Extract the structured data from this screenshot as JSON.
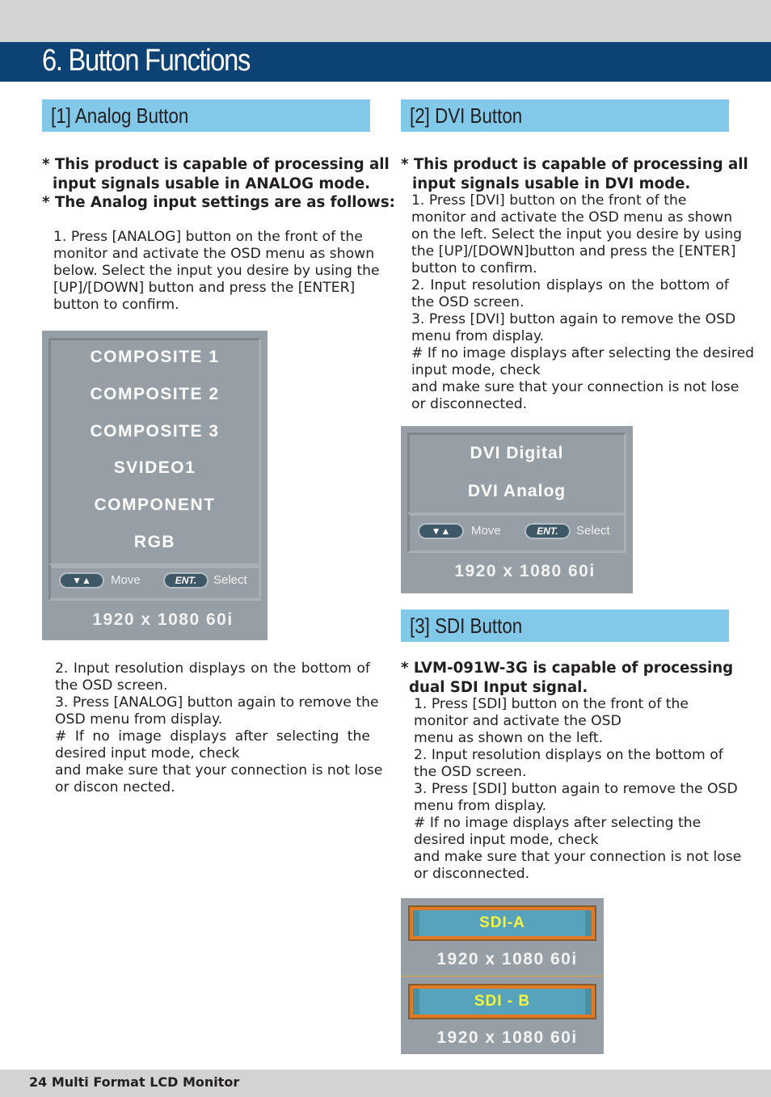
{
  "page": {
    "title": "6. Button Functions",
    "footer": "24 Multi Format LCD Monitor"
  },
  "analog": {
    "heading": "[1] Analog Button",
    "intro": [
      "* This product is capable of processing all",
      "input signals usable in ANALOG mode.",
      "* The Analog input settings are as follows:"
    ],
    "step1": [
      "1. Press [ANALOG] button on the front of the",
      "monitor and activate the OSD menu as shown",
      "below. Select the input you desire by using the",
      "[UP]/[DOWN] button and press the [ENTER]",
      "button to confirm."
    ],
    "osd": {
      "items": [
        "COMPOSITE 1",
        "COMPOSITE 2",
        "COMPOSITE 3",
        "SVIDEO1",
        "COMPONENT",
        "RGB"
      ],
      "move_key": "▼▲",
      "move_label": "Move",
      "enter_key": "ENT.",
      "select_label": "Select",
      "resolution": "1920 x 1080 60i"
    },
    "steps_after": [
      {
        "text": "2. Input resolution displays on the bottom of",
        "justify": true
      },
      {
        "text": "the OSD screen.",
        "justify": false
      },
      {
        "text": "3. Press [ANALOG] button again to remove the",
        "justify": false
      },
      {
        "text": "OSD menu from display.",
        "justify": false
      },
      {
        "text": "# If no image displays after selecting the",
        "justify": true
      },
      {
        "text": "desired input mode, check",
        "justify": false
      },
      {
        "text": "and make sure that your connection is not lose",
        "justify": false
      },
      {
        "text": "or discon nected.",
        "justify": false
      }
    ]
  },
  "dvi": {
    "heading": "[2] DVI Button",
    "intro": [
      "* This product is capable of processing all",
      "input signals usable in DVI mode."
    ],
    "steps": [
      {
        "text": "1. Press [DVI] button on the front of the",
        "justify": false
      },
      {
        "text": "monitor and activate the OSD menu as shown",
        "justify": false
      },
      {
        "text": "on the left. Select the input you desire by using",
        "justify": false
      },
      {
        "text": "the [UP]/[DOWN]button and press the [ENTER]",
        "justify": false
      },
      {
        "text": "button to confirm.",
        "justify": false
      },
      {
        "text": "2. Input resolution displays on the bottom of",
        "justify": true
      },
      {
        "text": "the OSD screen.",
        "justify": false
      },
      {
        "text": "3. Press [DVI] button again to remove the OSD",
        "justify": true
      },
      {
        "text": "menu from display.",
        "justify": false
      },
      {
        "text": "# If no image displays after selecting the desired",
        "justify": false
      },
      {
        "text": "input mode, check",
        "justify": false
      },
      {
        "text": "and make sure that your connection is not lose",
        "justify": false
      },
      {
        "text": "or disconnected.",
        "justify": false
      }
    ],
    "osd": {
      "items": [
        "DVI Digital",
        "DVI Analog"
      ],
      "move_key": "▼▲",
      "move_label": "Move",
      "enter_key": "ENT.",
      "select_label": "Select",
      "resolution": "1920 x 1080 60i"
    }
  },
  "sdi": {
    "heading": "[3] SDI Button",
    "intro": [
      "* LVM-091W-3G is capable of processing",
      "dual SDI Input signal."
    ],
    "steps": [
      "1. Press [SDI] button on the front of the",
      "monitor and activate the OSD",
      "menu as shown on the left.",
      "2. Input resolution displays on the bottom of",
      "the OSD screen.",
      "3. Press [SDI] button again to remove the OSD",
      "menu from display.",
      "# If no image displays after selecting the",
      "desired input mode, check",
      "and make sure that your connection is not lose",
      "or disconnected."
    ],
    "osd_a": {
      "label": "SDI-A",
      "resolution": "1920 x 1080 60i"
    },
    "osd_b": {
      "label": "SDI - B",
      "resolution": "1920 x 1080 60i"
    },
    "colors": {
      "bar_fill": "#56a3bb",
      "bar_border": "#e07a25",
      "label": "#f5f542"
    }
  }
}
